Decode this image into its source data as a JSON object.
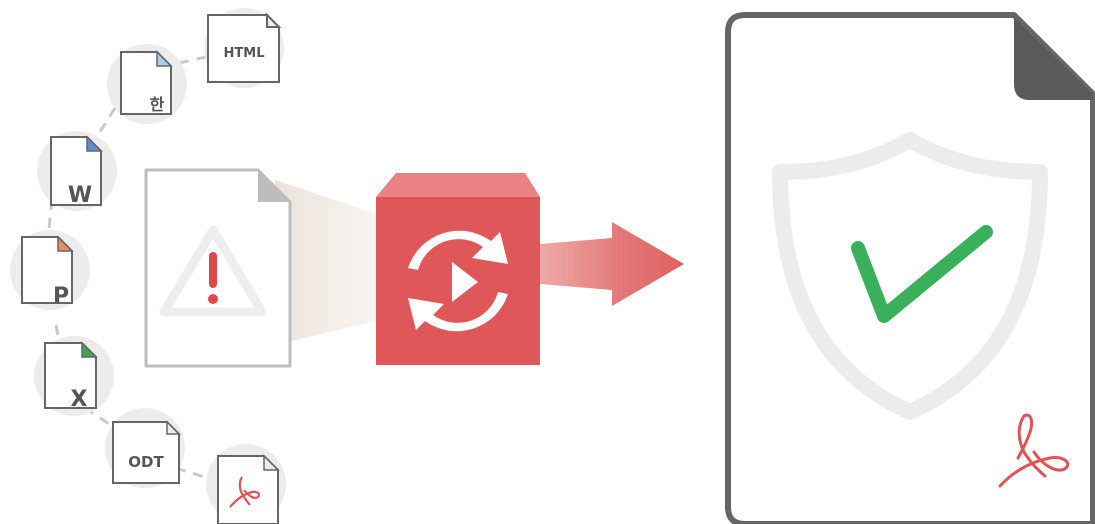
{
  "colors": {
    "background": "#ffffff",
    "circle_bg": "#ececec",
    "connector": "#c8c8c8",
    "doc_outline": "#666666",
    "doc_fold": "#5a5a5a",
    "hwp_tab": "#9ecff2",
    "word_tab": "#5d8fd0",
    "ppt_tab": "#ef8a5c",
    "excel_tab": "#35a852",
    "pdf_red": "#e05455",
    "warning_red": "#e0474c",
    "converter_front": "#e0575a",
    "converter_top": "#ea8284",
    "check_green": "#3bb05a",
    "shield_stroke": "#ececec"
  },
  "source_formats": [
    {
      "label": "HTML",
      "icon": "html-file-icon"
    },
    {
      "label": "한",
      "icon": "hwp-file-icon"
    },
    {
      "label": "W",
      "icon": "word-file-icon"
    },
    {
      "label": "P",
      "icon": "powerpoint-file-icon"
    },
    {
      "label": "X",
      "icon": "excel-file-icon"
    },
    {
      "label": "ODT",
      "icon": "odt-file-icon"
    },
    {
      "label": "",
      "icon": "pdf-file-icon"
    }
  ],
  "icons": {
    "input_doc": "warning-icon",
    "converter": "convert-arrows-icon",
    "arrow": "right-arrow-icon",
    "output_shield": "shield-icon",
    "output_check": "checkmark-icon",
    "output_pdf": "adobe-pdf-icon"
  }
}
